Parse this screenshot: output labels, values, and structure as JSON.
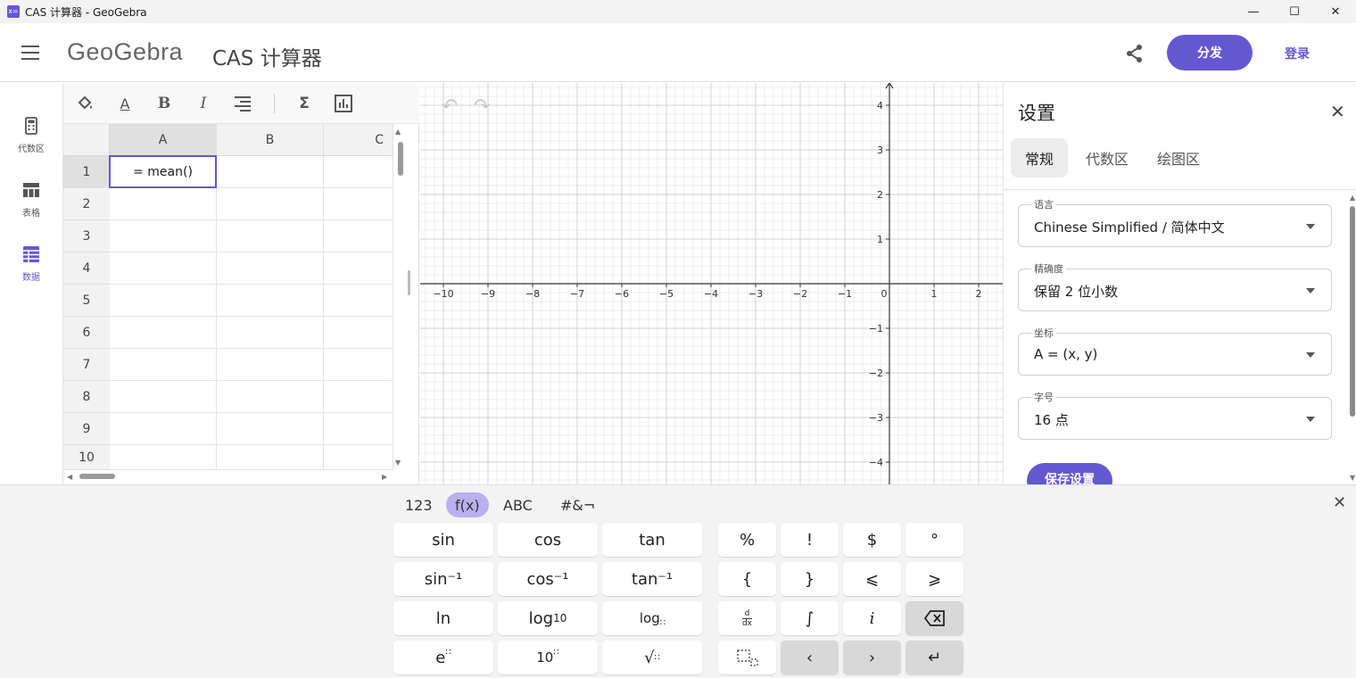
{
  "window": {
    "title": "CAS 计算器 - GeoGebra",
    "app_icon": "x="
  },
  "header": {
    "logo": "GeoGebra",
    "app_title": "CAS 计算器",
    "share_button": "分发",
    "login_button": "登录"
  },
  "leftnav": [
    {
      "label": "代数区",
      "icon": "calculator-icon"
    },
    {
      "label": "表格",
      "icon": "table-icon"
    },
    {
      "label": "数据",
      "icon": "data-grid-icon",
      "active": true
    }
  ],
  "sheet": {
    "columns": [
      "A",
      "B",
      "C"
    ],
    "rows": [
      "1",
      "2",
      "3",
      "4",
      "5",
      "6",
      "7",
      "8",
      "9",
      "10"
    ],
    "active_cell": {
      "ref": "A1",
      "value": "= mean()"
    }
  },
  "graph": {
    "x_ticks": [
      "−10",
      "−9",
      "−8",
      "−7",
      "−6",
      "−5",
      "−4",
      "−3",
      "−2",
      "−1",
      "0",
      "1",
      "2"
    ],
    "y_ticks": [
      "4",
      "3",
      "2",
      "1",
      "−1",
      "−2",
      "−3",
      "−4"
    ]
  },
  "settings": {
    "title": "设置",
    "tabs": [
      "常规",
      "代数区",
      "绘图区"
    ],
    "fields": [
      {
        "label": "语言",
        "value": "Chinese Simplified / 简体中文"
      },
      {
        "label": "精确度",
        "value": "保留 2 位小数"
      },
      {
        "label": "坐标",
        "value": "A = (x, y)"
      },
      {
        "label": "字号",
        "value": "16 点"
      }
    ],
    "save_button": "保存设置"
  },
  "keyboard": {
    "tabs": [
      "123",
      "f(x)",
      "ABC",
      "#&¬"
    ],
    "active_tab": "f(x)",
    "func_keys": [
      "sin",
      "cos",
      "tan",
      "sin⁻¹",
      "cos⁻¹",
      "tan⁻¹",
      "ln",
      "log",
      "log"
    ],
    "symbol_keys": [
      "%",
      "!",
      "$",
      "°",
      "{",
      "}",
      "⩽",
      "⩾",
      "∫",
      "i"
    ],
    "log10_base": "10",
    "exp_keys": [
      "e",
      "10"
    ]
  },
  "colors": {
    "accent": "#6557d2",
    "keyboard_tab_active": "#b9b0f0"
  }
}
